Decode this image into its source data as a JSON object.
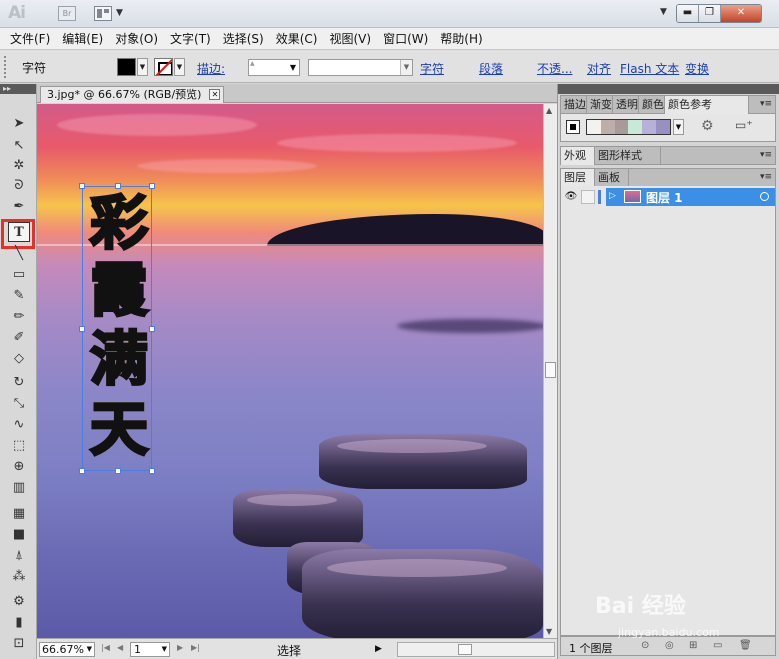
{
  "app": {
    "logo": "Ai",
    "bridge_label": "Br"
  },
  "menu": [
    "文件(F)",
    "编辑(E)",
    "对象(O)",
    "文字(T)",
    "选择(S)",
    "效果(C)",
    "视图(V)",
    "窗口(W)",
    "帮助(H)"
  ],
  "control_bar": {
    "label": "字符",
    "stroke_label": "描边:",
    "char_link": "字符",
    "paragraph_link": "段落",
    "opacity_link": "不透...",
    "align_link": "对齐",
    "flash_link": "Flash 文本",
    "transform_link": "变换"
  },
  "document": {
    "tab_title": "3.jpg* @ 66.67% (RGB/预览)",
    "vertical_text": [
      "彩",
      "霞",
      "满",
      "天"
    ]
  },
  "status": {
    "zoom": "66.67%",
    "page": "1",
    "tool_status": "选择"
  },
  "panels": {
    "top_tabs": [
      "描边",
      "渐变",
      "透明度",
      "颜色",
      "颜色参考"
    ],
    "mid_tabs": [
      "外观",
      "图形样式"
    ],
    "layer_tabs": [
      "图层",
      "画板"
    ],
    "layer_name": "图层 1",
    "layer_count": "1 个图层",
    "color_guide": [
      "#f4f2ee",
      "#bcaea8",
      "#a89a98",
      "#c8e8d8",
      "#b8b0d8",
      "#9890c0"
    ]
  },
  "watermark": {
    "brand": "Bai 经验",
    "url": "jingyan.baidu.com"
  },
  "colors": {
    "highlight": "#e8302a",
    "selection": "#4a7fe0",
    "layer_selected": "#3b8fe6"
  }
}
